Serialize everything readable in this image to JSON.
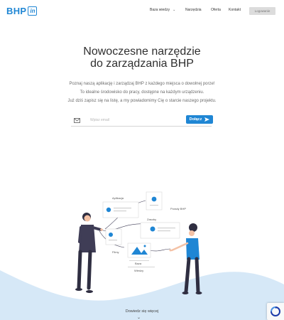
{
  "header": {
    "logo_main": "BHP",
    "logo_box": "in",
    "nav": [
      {
        "label": "Baza wiedzy",
        "has_dropdown": true
      },
      {
        "label": "Narzędzia",
        "has_dropdown": false
      },
      {
        "label": "Oferta",
        "has_dropdown": false
      },
      {
        "label": "Kontakt",
        "has_dropdown": false
      }
    ],
    "login_label": "Logowanie"
  },
  "hero": {
    "title_line1": "Nowoczesne narzędzie",
    "title_line2": "do zarządzania BHP",
    "paragraph_lines": [
      "Poznaj naszą aplikację i zarządzaj BHP z każdego miejsca o dowolnej porze!",
      "To idealne środowisko do pracy, dostępne na każdym urządzeniu.",
      "Już dziś zapisz się na listę, a my powiadomimy Cię o starcie naszego projektu."
    ]
  },
  "signup": {
    "email_placeholder": "Wpisz email",
    "join_label": "Dołącz",
    "mail_icon": "envelope-icon",
    "send_icon": "paper-plane-icon"
  },
  "illustration": {
    "labels": {
      "aplikacja": "Aplikacja",
      "porady": "Porady BHP",
      "zasoby": "Zasoby",
      "filmy": "Filmy",
      "baza": "Baza",
      "wiedzy": "Wiedzy"
    }
  },
  "footer": {
    "more_label": "Dowiedz się więcej",
    "more_icon": "chevron-down-icon"
  },
  "colors": {
    "brand": "#1f86d4",
    "wave": "#d6e8f7",
    "figure_dark": "#2f2e41"
  }
}
